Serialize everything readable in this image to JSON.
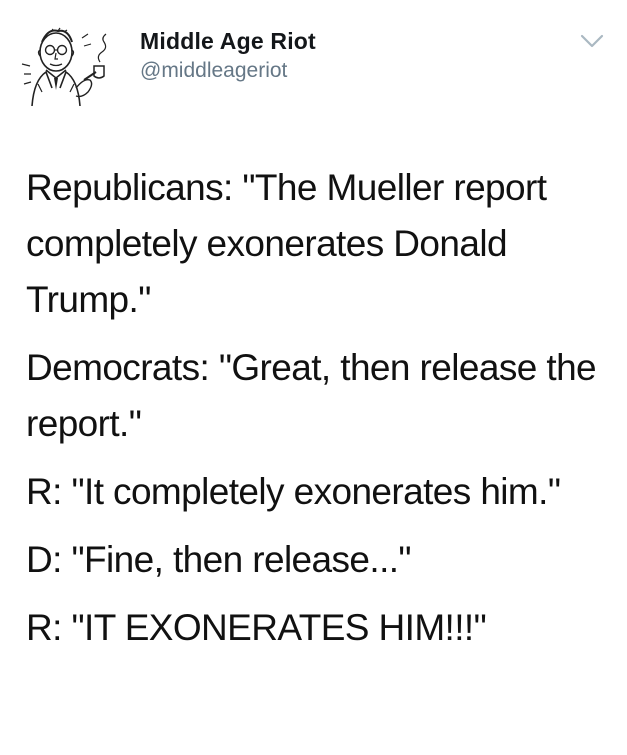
{
  "user": {
    "display_name": "Middle Age Riot",
    "handle": "@middleageriot",
    "avatar_icon": "cartoon-man-with-pipe-icon"
  },
  "menu": {
    "icon": "chevron-down-icon"
  },
  "tweet": {
    "paragraphs": [
      "Republicans: \"The Mueller report completely exonerates Donald Trump.\"",
      "Democrats: \"Great, then release the report.\"",
      "R: \"It completely exonerates him.\"",
      "D: \"Fine, then release...\"",
      "R: \"IT EXONERATES HIM!!!\""
    ]
  },
  "colors": {
    "name": "#14171a",
    "handle": "#657786",
    "text": "#111111",
    "caret": "#aab8c2"
  }
}
